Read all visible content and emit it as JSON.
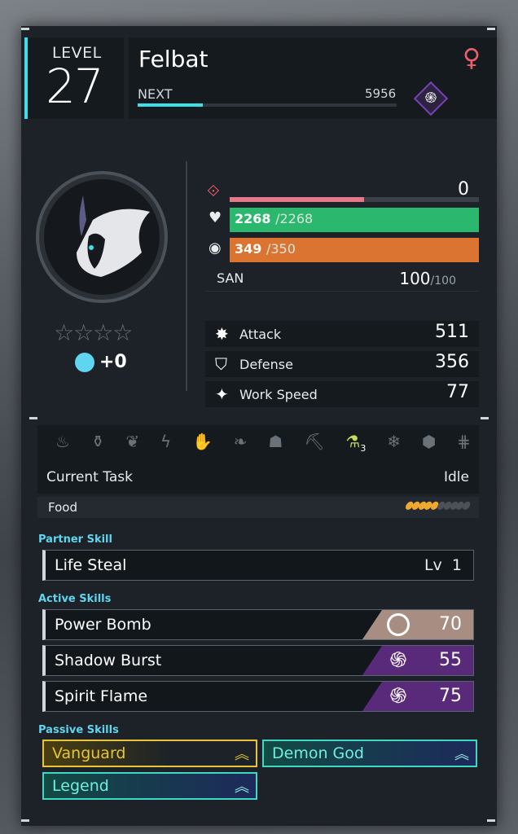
{
  "header": {
    "level_label": "LEVEL",
    "level": "27",
    "name": "Felbat",
    "gender_symbol": "♀",
    "next_label": "NEXT",
    "next_value": "5956",
    "xp_progress": 0.25,
    "element_icon": "dark-swirl-icon"
  },
  "stats": {
    "shield_value": "0",
    "shield_progress": 0.54,
    "hp_current": "2268",
    "hp_max": "/2268",
    "food_current": "349",
    "food_max": "/350",
    "san_label": "SAN",
    "san_value": "100",
    "san_max": "/100",
    "rank_stars": "☆☆☆☆",
    "condense_value": "+0",
    "attack_label": "Attack",
    "attack_value": "511",
    "defense_label": "Defense",
    "defense_value": "356",
    "workspeed_label": "Work Speed",
    "workspeed_value": "77"
  },
  "work": {
    "icons": [
      "kindling-icon",
      "watering-icon",
      "planting-icon",
      "electricity-icon",
      "handiwork-icon",
      "gathering-icon",
      "lumbering-icon",
      "mining-icon",
      "medicine-icon",
      "cooling-icon",
      "transporting-icon",
      "farming-icon"
    ],
    "medicine_level": "3",
    "current_task_label": "Current Task",
    "current_task_value": "Idle",
    "food_label": "Food",
    "food_filled": 5,
    "food_total": 10
  },
  "partner_skill": {
    "section_label": "Partner Skill",
    "name": "Life Steal",
    "level_label": "Lv",
    "level": "1"
  },
  "active_skills": {
    "section_label": "Active Skills",
    "items": [
      {
        "name": "Power Bomb",
        "value": "70",
        "element": "neutral"
      },
      {
        "name": "Shadow Burst",
        "value": "55",
        "element": "dark"
      },
      {
        "name": "Spirit Flame",
        "value": "75",
        "element": "dark"
      }
    ]
  },
  "passive_skills": {
    "section_label": "Passive Skills",
    "items": [
      {
        "name": "Vanguard",
        "color": "#e8c534",
        "rank_icon": "chevrons-up-icon"
      },
      {
        "name": "Demon God",
        "color": "#3fd8c4",
        "rank_icon": "chevrons-up-plus-icon"
      },
      {
        "name": "Legend",
        "color": "#3fd8c4",
        "rank_icon": "chevrons-up-plus-icon"
      }
    ]
  },
  "colors": {
    "accent": "#3ee0e8",
    "hp": "#2bb86e",
    "food": "#dc7431",
    "shield": "#e8596c",
    "dark_element": "#5a2a7a",
    "neutral_element": "#a88d82"
  }
}
